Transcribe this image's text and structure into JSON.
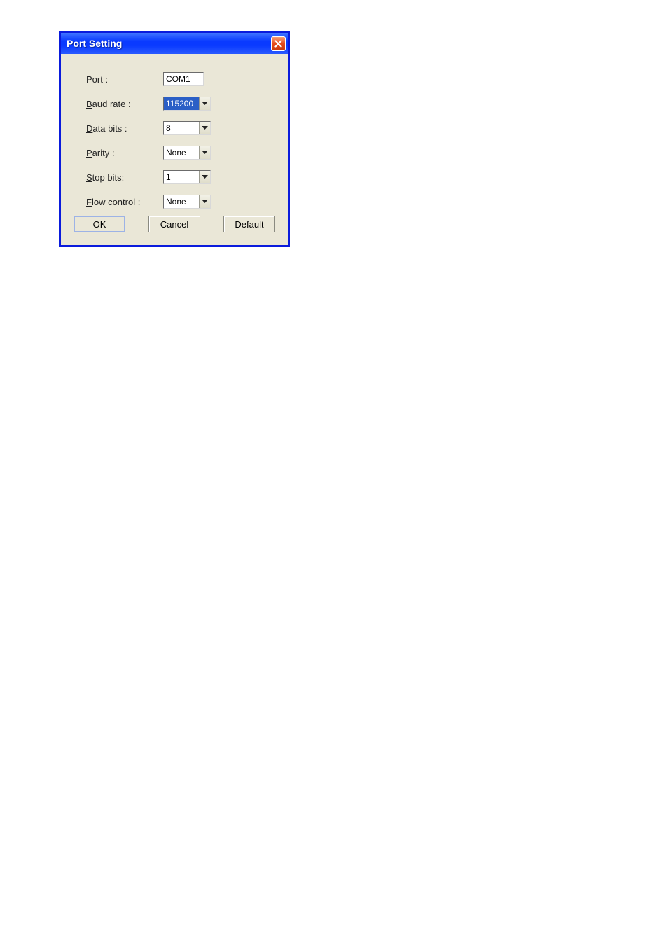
{
  "window": {
    "title": "Port Setting"
  },
  "labels": {
    "port": "Port :",
    "baud_pre": "B",
    "baud_post": "aud rate :",
    "data_pre": "D",
    "data_post": "ata bits :",
    "parity_pre": "P",
    "parity_post": "arity :",
    "stop_pre": "S",
    "stop_post": "top bits:",
    "flow_pre": "F",
    "flow_post": "low control :"
  },
  "values": {
    "port": "COM1",
    "baud": "115200",
    "data_bits": "8",
    "parity": "None",
    "stop_bits": "1",
    "flow_control": "None"
  },
  "buttons": {
    "ok_pre": "O",
    "ok_post": "K",
    "cancel_pre": "C",
    "cancel_post": "ancel",
    "default_pre": "D",
    "default_post": "efault"
  }
}
